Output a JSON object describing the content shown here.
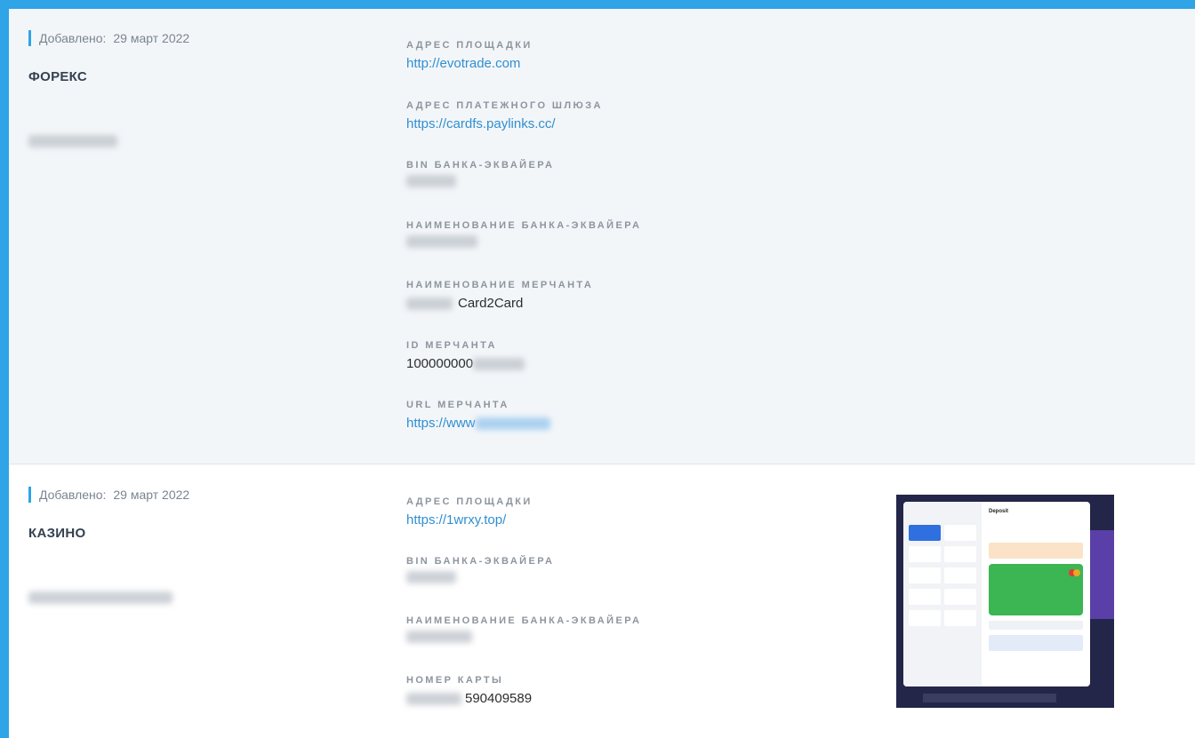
{
  "records": [
    {
      "added_label": "Добавлено:",
      "added_date": "29 март 2022",
      "category": "ФОРЕКС",
      "fields": [
        {
          "label": "АДРЕС ПЛОЩАДКИ",
          "value": "http://evotrade.com"
        },
        {
          "label": "АДРЕС ПЛАТЕЖНОГО ШЛЮЗА",
          "value": "https://cardfs.paylinks.cc/"
        },
        {
          "label": "BIN БАНКА-ЭКВАЙЕРА",
          "value": ""
        },
        {
          "label": "НАИМЕНОВАНИЕ БАНКА-ЭКВАЙЕРА",
          "value": ""
        },
        {
          "label": "НАИМЕНОВАНИЕ МЕРЧАНТА",
          "value": "Card2Card"
        },
        {
          "label": "ID МЕРЧАНТА",
          "value": "100000000"
        },
        {
          "label": "URL МЕРЧАНТА",
          "value": "https://www"
        }
      ]
    },
    {
      "added_label": "Добавлено:",
      "added_date": "29 март 2022",
      "category": "КАЗИНО",
      "fields": [
        {
          "label": "АДРЕС ПЛОЩАДКИ",
          "value": "https://1wrxy.top/"
        },
        {
          "label": "BIN БАНКА-ЭКВАЙЕРА",
          "value": ""
        },
        {
          "label": "НАИМЕНОВАНИЕ БАНКА-ЭКВАЙЕРА",
          "value": ""
        },
        {
          "label": "НОМЕР КАРТЫ",
          "value": "590409589"
        }
      ],
      "screenshot": {
        "title": "Deposit"
      }
    }
  ],
  "colors": {
    "accent": "#2fa4e7",
    "link": "#2f8fd0",
    "label": "#8d959e"
  }
}
